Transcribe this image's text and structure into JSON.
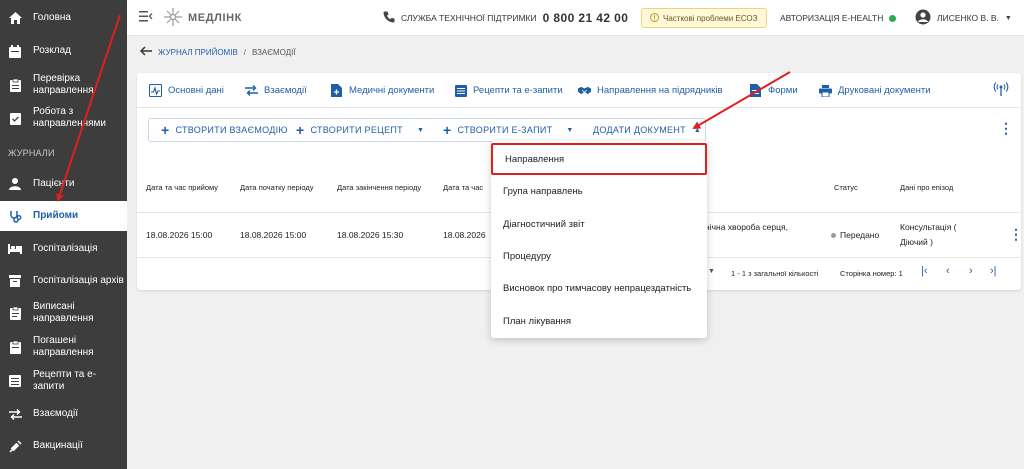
{
  "sidebar": {
    "section_label": "ЖУРНАЛИ",
    "items": [
      {
        "label": "Головна"
      },
      {
        "label": "Розклад"
      },
      {
        "label": "Перевірка направлення"
      },
      {
        "label": "Робота з направленнями"
      },
      {
        "label": "Пацієнти"
      },
      {
        "label": "Прийоми"
      },
      {
        "label": "Госпіталізація"
      },
      {
        "label": "Госпіталізація архів"
      },
      {
        "label": "Виписані направлення"
      },
      {
        "label": "Погашені направлення"
      },
      {
        "label": "Рецепти та е-запити"
      },
      {
        "label": "Взаємодії"
      },
      {
        "label": "Вакцинації"
      }
    ]
  },
  "topbar": {
    "logo": "МЕДЛІНК",
    "support_label": "СЛУЖБА ТЕХНІЧНОЇ ПІДТРИМКИ",
    "support_phone": "0 800 21 42 00",
    "warning": "Часткові проблеми ЕСОЗ",
    "auth": "АВТОРИЗАЦІЯ E-HEALTH",
    "user": "ЛИСЕНКО В. В."
  },
  "breadcrumb": {
    "parent": "ЖУРНАЛ ПРИЙОМІВ",
    "separator": "/",
    "current": "ВЗАЄМОДІЇ"
  },
  "tabs": [
    {
      "label": "Основні дані"
    },
    {
      "label": "Взаємодії"
    },
    {
      "label": "Медичні документи"
    },
    {
      "label": "Рецепти та е-запити"
    },
    {
      "label": "Направлення на підрядників"
    },
    {
      "label": "Форми"
    },
    {
      "label": "Друковані документи"
    }
  ],
  "actions": {
    "create_interaction": "СТВОРИТИ ВЗАЄМОДІЮ",
    "create_recipe": "СТВОРИТИ РЕЦЕПТ",
    "create_erequest": "СТВОРИТИ Е-ЗАПИТ",
    "add_document": "ДОДАТИ ДОКУМЕНТ"
  },
  "table": {
    "headers": [
      "Дата та час прийому",
      "Дата початку періоду",
      "Дата закінчення періоду",
      "Дата та час",
      "Статус",
      "Дані про епізод"
    ],
    "row": {
      "c1": "18.08.2026 15:00",
      "c2": "18.08.2026 15:00",
      "c3": "18.08.2026 15:30",
      "c4": "18.08.2026",
      "diagnosis": "нічна хвороба серця,",
      "status": "Передано",
      "episode_line1": "Консультація (",
      "episode_line2": "Діючий )"
    }
  },
  "pager": {
    "count": "1 - 1 з загальної кількості",
    "page": "Сторінка номер: 1"
  },
  "dropdown": {
    "items": [
      "Направлення",
      "Група направлень",
      "Діагностичний звіт",
      "Процедуру",
      "Висновок про тимчасову непрацездатність",
      "План лікування"
    ]
  },
  "colors": {
    "accent": "#1f5fa8",
    "sidebar": "#3d3d3d",
    "highlight": "#e02020",
    "status_ok": "#2eaa4a"
  }
}
